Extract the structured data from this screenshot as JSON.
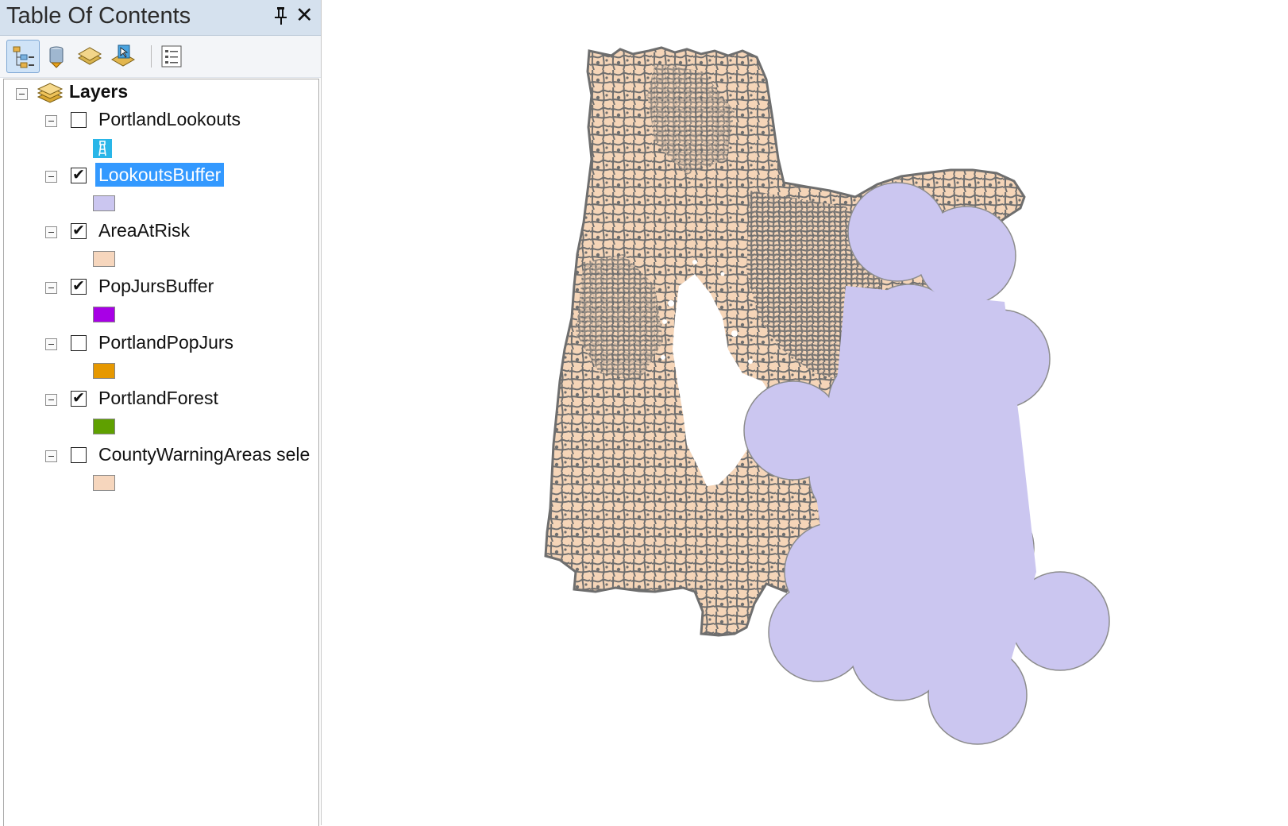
{
  "toc": {
    "title": "Table Of Contents",
    "pin_icon": "pin-icon",
    "close_glyph": "✕",
    "toolbar": [
      {
        "name": "list-by-drawing-order-icon",
        "active": true
      },
      {
        "name": "list-by-source-icon",
        "active": false
      },
      {
        "name": "list-by-visibility-icon",
        "active": false
      },
      {
        "name": "list-by-selection-icon",
        "active": false
      },
      {
        "name": "options-icon",
        "active": false
      }
    ],
    "root_label": "Layers",
    "layers": [
      {
        "label": "PortlandLookouts",
        "checked": false,
        "selected": false,
        "swatch": "#29b6e8",
        "swatch_icon": "lookout-tower-icon"
      },
      {
        "label": "LookoutsBuffer",
        "checked": true,
        "selected": true,
        "swatch": "#cbc6f0"
      },
      {
        "label": "AreaAtRisk",
        "checked": true,
        "selected": false,
        "swatch": "#f6d6bd"
      },
      {
        "label": "PopJursBuffer",
        "checked": true,
        "selected": false,
        "swatch": "#a800e6"
      },
      {
        "label": "PortlandPopJurs",
        "checked": false,
        "selected": false,
        "swatch": "#e69800"
      },
      {
        "label": "PortlandForest",
        "checked": true,
        "selected": false,
        "swatch": "#5fa000"
      },
      {
        "label": "CountyWarningAreas sele",
        "checked": false,
        "selected": false,
        "swatch": "#f6d6bd"
      }
    ]
  },
  "map": {
    "colors": {
      "land_fill": "#f5d5b8",
      "land_outline": "#6e6e6e",
      "buffer_fill": "#cbc6f0",
      "buffer_outline": "#8c8c8c"
    }
  }
}
